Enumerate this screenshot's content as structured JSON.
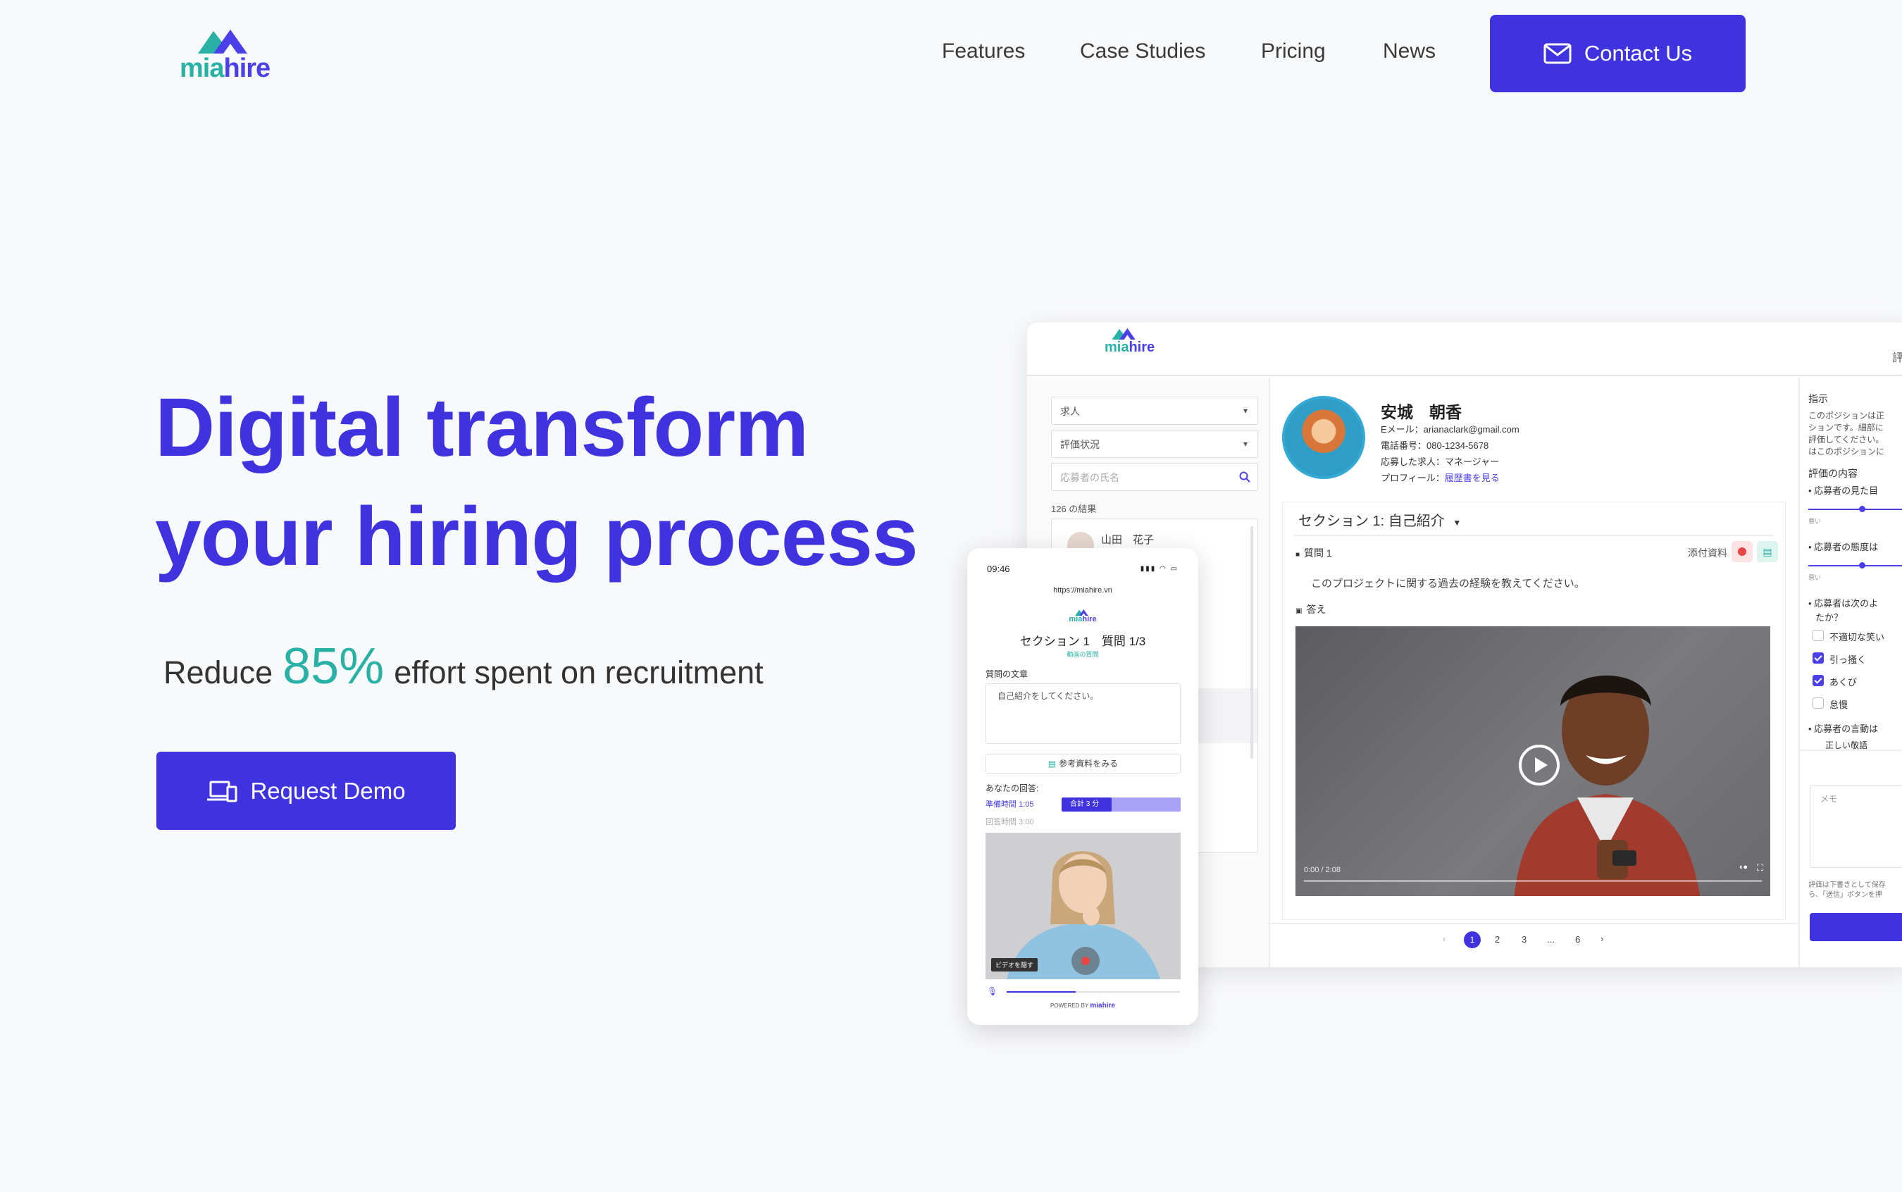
{
  "brand": {
    "logo_part1": "mia",
    "logo_part2": "hire",
    "accent": "#3f33e0",
    "teal": "#2ab1a6"
  },
  "nav": {
    "items": [
      "Features",
      "Case Studies",
      "Pricing",
      "News"
    ],
    "contact_label": "Contact Us"
  },
  "hero": {
    "title_line1": "Digital transform",
    "title_line2": "your hiring process",
    "reduce_prefix": "Reduce",
    "reduce_pct": "85%",
    "reduce_suffix": "effort spent on recruitment",
    "demo_label": "Request Demo"
  },
  "desktop": {
    "right_header_cut": "評価",
    "filters": {
      "job": "求人",
      "status": "評価状況",
      "search_placeholder": "応募者の氏名"
    },
    "results_count": "126 の結果",
    "list_first_name": "山田　花子",
    "candidate": {
      "name": "安城　朝香",
      "email": "Eメール：arianaclark@gmail.com",
      "phone": "電話番号：080-1234-5678",
      "applied": "応募した求人：マネージャー",
      "profile_label": "プロフィール：",
      "profile_link": "履歴書を見る"
    },
    "section_title": "セクション 1: 自己紹介",
    "question_label": "質問 1",
    "attachment_label": "添付資料",
    "question_text": "このプロジェクトに関する過去の経験を教えてください。",
    "answer_label": "答え",
    "video_time": "0:00 / 2:08",
    "pager": [
      "1",
      "2",
      "3",
      "...",
      "6"
    ],
    "right_panel": {
      "instructions_title": "指示",
      "instructions_lines": [
        "このポジションは正",
        "ションです。細部に",
        "評価してください。",
        "はこのポジションに"
      ],
      "eval_title": "評価の内容",
      "criteria1": "• 応募者の見た目",
      "scale_low": "悪い",
      "criteria2": "• 応募者の態度は",
      "criteria3_line1": "• 応募者は次のよ",
      "criteria3_line2": "たか？",
      "options": [
        {
          "label": "不適切な笑い",
          "checked": false
        },
        {
          "label": "引っ掻く",
          "checked": true
        },
        {
          "label": "あくび",
          "checked": true
        },
        {
          "label": "怠慢",
          "checked": false
        }
      ],
      "criteria4": "• 応募者の言動は",
      "criteria4_cut": "正しい敬語",
      "memo_placeholder": "メモ",
      "note_line1": "評価は下書きとして保存",
      "note_line2": "ら、「送信」ボタンを押"
    }
  },
  "phone": {
    "time": "09:46",
    "status_icons": "▮▮▮ ◠ ▭",
    "url": "https://miahire.vn",
    "section": "セクション 1　質問 1/3",
    "sub": "動画の質問",
    "question_label": "質問の文章",
    "question_text": "自己紹介をしてください。",
    "reference_label": "参考資料をみる",
    "your_answer": "あなたの回答:",
    "prep_time": "準備時間  1:05",
    "total": "合計 3 分",
    "answer_time": "回答時間  3:00",
    "video_tag": "ビデオを隠す",
    "powered_prefix": "POWERED BY",
    "powered_brand": "miahire",
    "mic_level": 0.4
  }
}
